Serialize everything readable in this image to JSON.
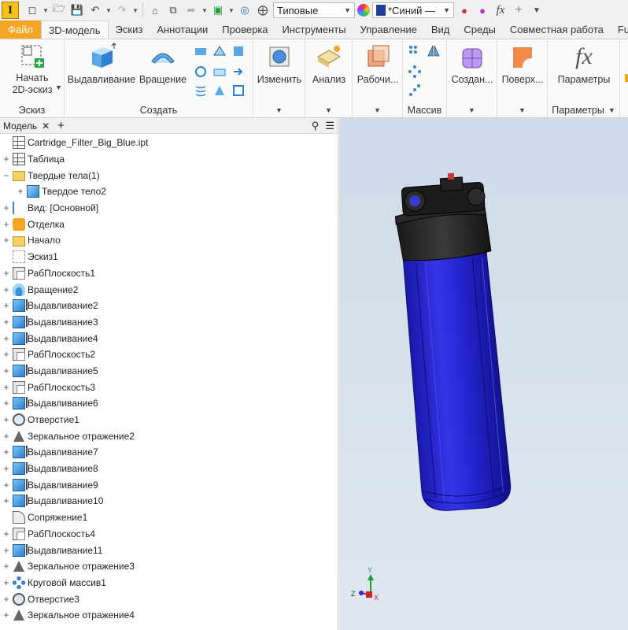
{
  "qat": {
    "app_letter": "I",
    "appearance": "Типовые",
    "color": "*Синий —",
    "fx_label": "fx"
  },
  "tabs": [
    "Файл",
    "3D-модель",
    "Эскиз",
    "Аннотации",
    "Проверка",
    "Инструменты",
    "Управление",
    "Вид",
    "Среды",
    "Совместная работа",
    "Fu"
  ],
  "ribbon": {
    "start_sketch": "Начать\n2D-эскиз",
    "group_sketch": "Эскиз",
    "extrude": "Выдавливание",
    "revolve": "Вращение",
    "group_create": "Создать",
    "modify": "Изменить",
    "analysis": "Анализ",
    "work": "Рабочи...",
    "group_pattern": "Массив",
    "create_freeform": "Создан...",
    "surface": "Поверх...",
    "parameters": "Параметры",
    "group_parameters": "Параметры"
  },
  "browser": {
    "tab_label": "Модель",
    "items": [
      {
        "label": "Cartridge_Filter_Big_Blue.ipt",
        "indent": 0,
        "toggle": "",
        "icon": "file"
      },
      {
        "label": "Таблица",
        "indent": 0,
        "toggle": "+",
        "icon": "table"
      },
      {
        "label": "Твердые тела(1)",
        "indent": 0,
        "toggle": "−",
        "icon": "folder"
      },
      {
        "label": "Твердое тело2",
        "indent": 1,
        "toggle": "+",
        "icon": "body"
      },
      {
        "label": "Вид: [Основной]",
        "indent": 0,
        "toggle": "+",
        "icon": "view"
      },
      {
        "label": "Отделка",
        "indent": 0,
        "toggle": "+",
        "icon": "app"
      },
      {
        "label": "Начало",
        "indent": 0,
        "toggle": "+",
        "icon": "folder"
      },
      {
        "label": "Эскиз1",
        "indent": 0,
        "toggle": "",
        "icon": "sketch"
      },
      {
        "label": "РабПлоскость1",
        "indent": 0,
        "toggle": "+",
        "icon": "plane"
      },
      {
        "label": "Вращение2",
        "indent": 0,
        "toggle": "+",
        "icon": "rev"
      },
      {
        "label": "Выдавливание2",
        "indent": 0,
        "toggle": "+",
        "icon": "ext"
      },
      {
        "label": "Выдавливание3",
        "indent": 0,
        "toggle": "+",
        "icon": "ext"
      },
      {
        "label": "Выдавливание4",
        "indent": 0,
        "toggle": "+",
        "icon": "ext"
      },
      {
        "label": "РабПлоскость2",
        "indent": 0,
        "toggle": "+",
        "icon": "plane"
      },
      {
        "label": "Выдавливание5",
        "indent": 0,
        "toggle": "+",
        "icon": "ext"
      },
      {
        "label": "РабПлоскость3",
        "indent": 0,
        "toggle": "+",
        "icon": "plane"
      },
      {
        "label": "Выдавливание6",
        "indent": 0,
        "toggle": "+",
        "icon": "ext"
      },
      {
        "label": "Отверстие1",
        "indent": 0,
        "toggle": "+",
        "icon": "hole"
      },
      {
        "label": "Зеркальное отражение2",
        "indent": 0,
        "toggle": "+",
        "icon": "mirror"
      },
      {
        "label": "Выдавливание7",
        "indent": 0,
        "toggle": "+",
        "icon": "ext"
      },
      {
        "label": "Выдавливание8",
        "indent": 0,
        "toggle": "+",
        "icon": "ext"
      },
      {
        "label": "Выдавливание9",
        "indent": 0,
        "toggle": "+",
        "icon": "ext"
      },
      {
        "label": "Выдавливание10",
        "indent": 0,
        "toggle": "+",
        "icon": "ext"
      },
      {
        "label": "Сопряжение1",
        "indent": 0,
        "toggle": "",
        "icon": "fillet"
      },
      {
        "label": "РабПлоскость4",
        "indent": 0,
        "toggle": "+",
        "icon": "plane"
      },
      {
        "label": "Выдавливание11",
        "indent": 0,
        "toggle": "+",
        "icon": "ext"
      },
      {
        "label": "Зеркальное отражение3",
        "indent": 0,
        "toggle": "+",
        "icon": "mirror"
      },
      {
        "label": "Круговой массив1",
        "indent": 0,
        "toggle": "+",
        "icon": "circ"
      },
      {
        "label": "Отверстие3",
        "indent": 0,
        "toggle": "+",
        "icon": "hole"
      },
      {
        "label": "Зеркальное отражение4",
        "indent": 0,
        "toggle": "+",
        "icon": "mirror"
      }
    ]
  },
  "viewport": {
    "axis_y": "Y",
    "axis_x": "X",
    "axis_z": "Z",
    "model_color": "#2a2ad8"
  }
}
